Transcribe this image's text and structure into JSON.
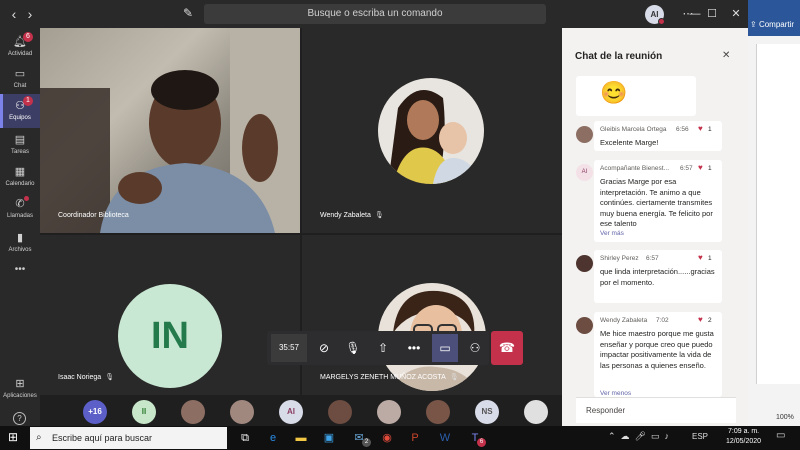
{
  "titlebar": {
    "search_placeholder": "Busque o escriba un comando",
    "user_initials": "AI",
    "back_icon": "chevron-left-icon",
    "forward_icon": "chevron-right-icon"
  },
  "word": {
    "share_label": "Compartir",
    "zoom": "100%"
  },
  "rail": {
    "items": [
      {
        "label": "Actividad",
        "badge": "6"
      },
      {
        "label": "Chat",
        "badge": ""
      },
      {
        "label": "Equipos",
        "badge": "1"
      },
      {
        "label": "Tareas",
        "badge": ""
      },
      {
        "label": "Calendario",
        "badge": ""
      },
      {
        "label": "Llamadas",
        "badge": ""
      },
      {
        "label": "Archivos",
        "badge": ""
      },
      {
        "label": "Aplicaciones",
        "badge": ""
      }
    ],
    "more": "•••",
    "help": "?"
  },
  "tiles": [
    {
      "name": "Coordinador Biblioteca"
    },
    {
      "name": "Wendy Zabaleta"
    },
    {
      "name": "Isaac Noriega",
      "initials": "IN"
    },
    {
      "name": "MARGELYS ZENETH MUÑOZ ACOSTA"
    }
  ],
  "controls": {
    "timer": "35:57",
    "more": "•••"
  },
  "participants": [
    {
      "label": "+16",
      "bg": "#5b5fc7",
      "fg": "#ffffff"
    },
    {
      "label": "II",
      "bg": "#c8e6c9",
      "fg": "#2e7d32"
    },
    {
      "label": "",
      "bg": "#8d6e63",
      "fg": "#ffffff"
    },
    {
      "label": "",
      "bg": "#a1887f",
      "fg": "#ffffff"
    },
    {
      "label": "AI",
      "bg": "#d8dbe8",
      "fg": "#8a3c5f"
    },
    {
      "label": "",
      "bg": "#6d4c41",
      "fg": "#ffffff"
    },
    {
      "label": "",
      "bg": "#bcaaa4",
      "fg": "#ffffff"
    },
    {
      "label": "",
      "bg": "#795548",
      "fg": "#ffffff"
    },
    {
      "label": "NS",
      "bg": "#d8dbe8",
      "fg": "#555555"
    },
    {
      "label": "",
      "bg": "#e0e0e0",
      "fg": "#333333"
    }
  ],
  "chat": {
    "title": "Chat de la reunión",
    "emoji": "😊",
    "messages": [
      {
        "sender": "Gleibis Marcela Ortega",
        "time": "6:56",
        "likes": "1",
        "body": "Excelente Marge!"
      },
      {
        "sender": "Acompañante Bienest...",
        "time": "6:57",
        "likes": "1",
        "initials": "AI",
        "body": "Gracias Marge por esa interpretación. Te animo a que continúes. ciertamente transmites muy buena energía. Te felicito por ese talento",
        "more": "Ver más"
      },
      {
        "sender": "Shirley Perez",
        "time": "6:57",
        "likes": "1",
        "body": "que linda interpretación......gracias por el momento."
      },
      {
        "sender": "Wendy Zabaleta",
        "time": "7:02",
        "likes": "2",
        "body": "Me hice maestro porque me gusta enseñar y porque creo que puedo impactar positivamente la vida de las personas a quienes enseño.",
        "more": "Ver menos"
      }
    ],
    "reply_placeholder": "Responder"
  },
  "taskbar": {
    "search_placeholder": "Escribe aquí para buscar",
    "tray": "ESP",
    "time": "7:09 a. m.",
    "date": "12/05/2020",
    "teams_badge": "6",
    "edge_badge": "2"
  }
}
